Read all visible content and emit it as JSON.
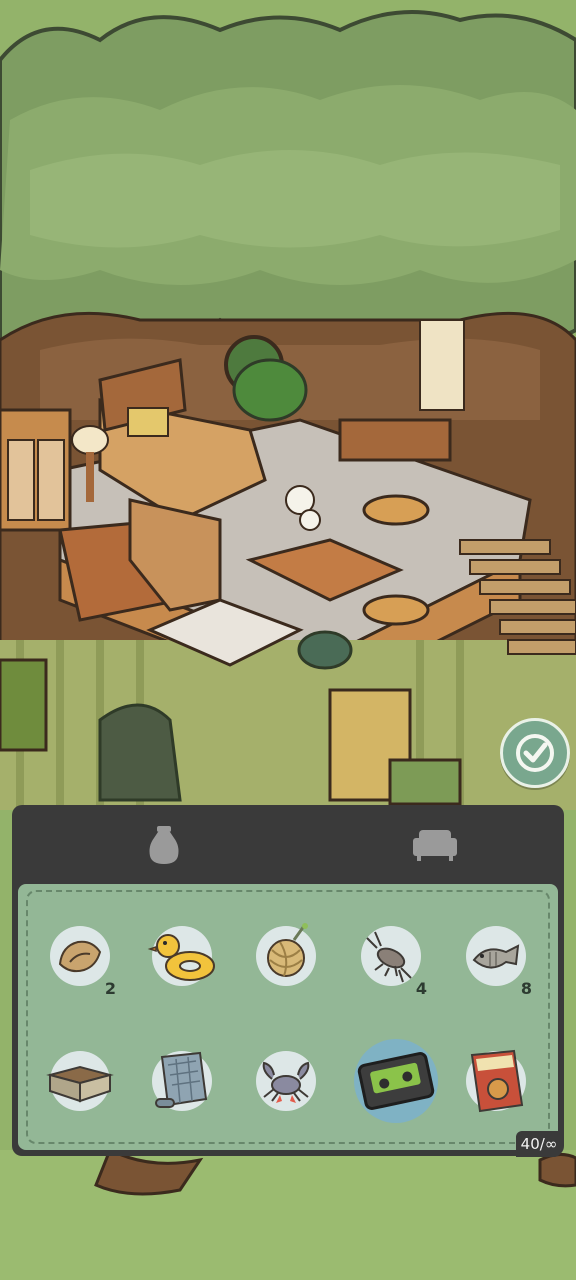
{
  "inventory": {
    "tabs": [
      {
        "icon": "bag-icon",
        "active": true
      },
      {
        "icon": "sofa-icon",
        "active": false
      }
    ],
    "capacity": "40/∞",
    "items": [
      {
        "icon": "seashell-icon",
        "count": "2"
      },
      {
        "icon": "rubber-duck-float-icon",
        "count": ""
      },
      {
        "icon": "yarn-ball-icon",
        "count": ""
      },
      {
        "icon": "crayfish-icon",
        "count": "4"
      },
      {
        "icon": "fish-icon",
        "count": "8"
      },
      {
        "icon": "planter-box-icon",
        "count": ""
      },
      {
        "icon": "map-scroll-icon",
        "count": ""
      },
      {
        "icon": "crab-icon",
        "count": ""
      },
      {
        "icon": "cassette-tape-icon",
        "count": "",
        "selected": true
      },
      {
        "icon": "magazine-icon",
        "count": ""
      }
    ]
  },
  "colors": {
    "panel_dark": "#3a3a3a",
    "panel_green": "#93b796",
    "slot_bg": "#dde7e7",
    "slot_selected": "#7fb2c4",
    "confirm_button": "#79a78e"
  }
}
